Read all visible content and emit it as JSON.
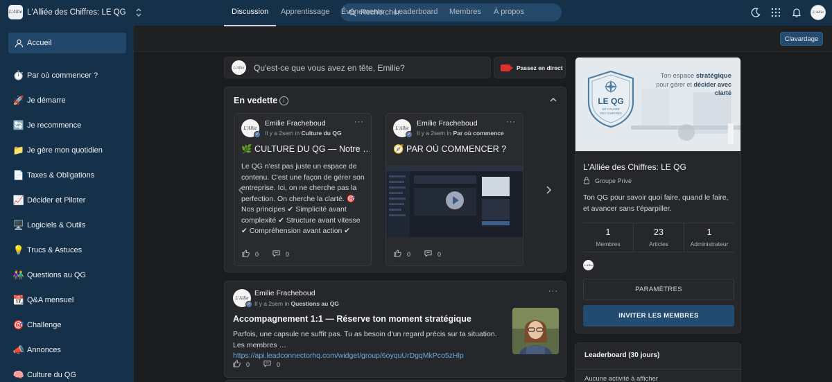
{
  "brand": {
    "name": "L'Alliée des Chiffres: LE QG",
    "logo_text": "L'Allie"
  },
  "search": {
    "placeholder": "Rechercher"
  },
  "sidebar": {
    "items": [
      {
        "label": "Accueil",
        "icon": "user-icon",
        "active": true
      },
      {
        "label": "Par où commencer ?",
        "icon": "stopwatch-icon"
      },
      {
        "label": "Je démarre",
        "icon": "rocket-icon"
      },
      {
        "label": "Je recommence",
        "icon": "refresh-icon"
      },
      {
        "label": "Je gère mon quotidien",
        "icon": "folder-icon"
      },
      {
        "label": "Taxes & Obligations",
        "icon": "document-icon"
      },
      {
        "label": "Décider et Piloter",
        "icon": "chart-icon"
      },
      {
        "label": "Logiciels & Outils",
        "icon": "computer-icon"
      },
      {
        "label": "Trucs & Astuces",
        "icon": "lightbulb-icon"
      },
      {
        "label": "Questions au QG",
        "icon": "people-icon"
      },
      {
        "label": "Q&A mensuel",
        "icon": "calendar-icon"
      },
      {
        "label": "Challenge",
        "icon": "target-icon"
      },
      {
        "label": "Annonces",
        "icon": "megaphone-icon"
      },
      {
        "label": "Culture du QG",
        "icon": "brain-icon"
      }
    ]
  },
  "tabs": [
    "Discussion",
    "Apprentissage",
    "Événements",
    "Leaderboard",
    "Membres",
    "À propos"
  ],
  "chat_button": "Clavardage",
  "composer": {
    "placeholder": "Qu'est-ce que vous avez en tête, Emilie?",
    "live_label": "Passez en direct"
  },
  "featured": {
    "title": "En vedette",
    "cards": [
      {
        "author": "Emilie Fracheboud",
        "time": "Il y a 2sem",
        "in_word": "in",
        "category": "Culture du QG",
        "title": "🌿 CULTURE DU QG — Notre …",
        "body": "Le QG n'est pas juste un espace de contenu. C'est une façon de gérer son entreprise. Ici, on ne cherche pas la perfection. On cherche la clarté. 🎯 Nos principes ✔ Simplicité avant complexité ✔ Structure avant vitesse ✔ Compréhension avant action ✔",
        "likes": "0",
        "comments": "0"
      },
      {
        "author": "Emilie Fracheboud",
        "time": "Il y a 2sem",
        "in_word": "in",
        "category": "Par où commence",
        "title": "🧭 PAR OÙ COMMENCER ?",
        "likes": "0",
        "comments": "0"
      }
    ]
  },
  "post": {
    "author": "Emilie Fracheboud",
    "time": "Il y a 2sem",
    "in_word": "in",
    "category": "Questions au QG",
    "title": "Accompagnement 1:1 — Réserve ton moment stratégique",
    "body": "Parfois, une capsule ne suffit pas. Tu as besoin d'un regard précis sur ta situation. Les membres …",
    "link": "https://api.leadconnectorhq.com/widget/group/6oyquUrDgqMkPco5zHlp",
    "likes": "0",
    "comments": "0"
  },
  "group": {
    "cover_line1_a": "Ton espace ",
    "cover_line1_b": "stratégique",
    "cover_line2_a": "pour gérer et ",
    "cover_line2_b": "décider avec clarté",
    "badge_title": "LE QG",
    "badge_sub1": "DE L'ALLIÉE",
    "badge_sub2": "DES CHIFFRES",
    "title": "L'Alliée des Chiffres: LE QG",
    "privacy": "Groupe Privé",
    "description": "Ton QG pour savoir quoi faire, quand le faire, et avancer sans t'éparpiller.",
    "stats": [
      {
        "num": "1",
        "label": "Membres"
      },
      {
        "num": "23",
        "label": "Articles"
      },
      {
        "num": "1",
        "label": "Administrateur"
      }
    ],
    "settings_button": "PARAMÈTRES",
    "invite_button": "INVITER LES MEMBRES"
  },
  "leaderboard": {
    "title": "Leaderboard (30 jours)",
    "empty": "Aucune activité à afficher"
  }
}
